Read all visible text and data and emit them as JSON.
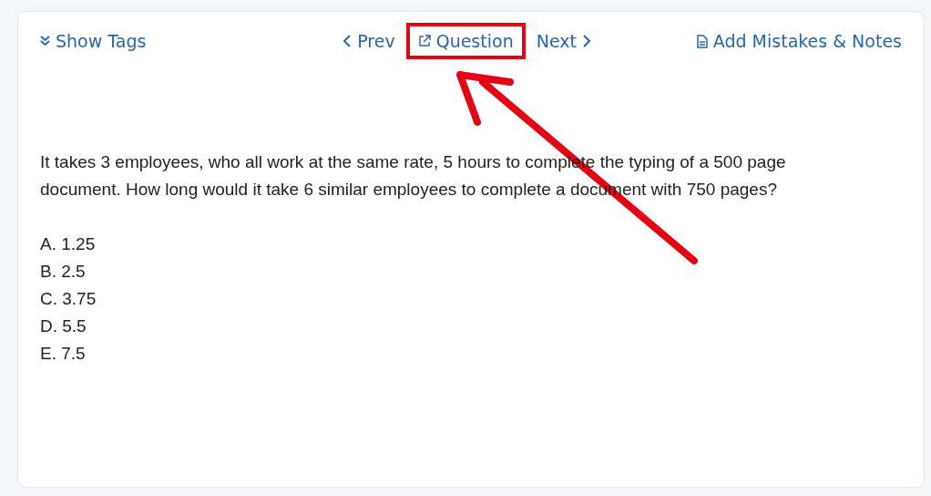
{
  "toolbar": {
    "show_tags": "Show Tags",
    "nav": [
      {
        "kind": "prev",
        "label": "Prev",
        "highlighted": false
      },
      {
        "kind": "question",
        "label": "Question",
        "highlighted": true
      },
      {
        "kind": "next",
        "label": "Next",
        "highlighted": false
      }
    ],
    "notes": "Add Mistakes & Notes"
  },
  "question": {
    "text": "It takes 3 employees, who all work at the same rate, 5 hours to complete the typing of a 500 page document. How long would it take 6 similar employees to complete a document with 750 pages?",
    "options": [
      "A. 1.25",
      "B. 2.5",
      "C. 3.75",
      "D. 5.5",
      "E. 7.5"
    ]
  }
}
